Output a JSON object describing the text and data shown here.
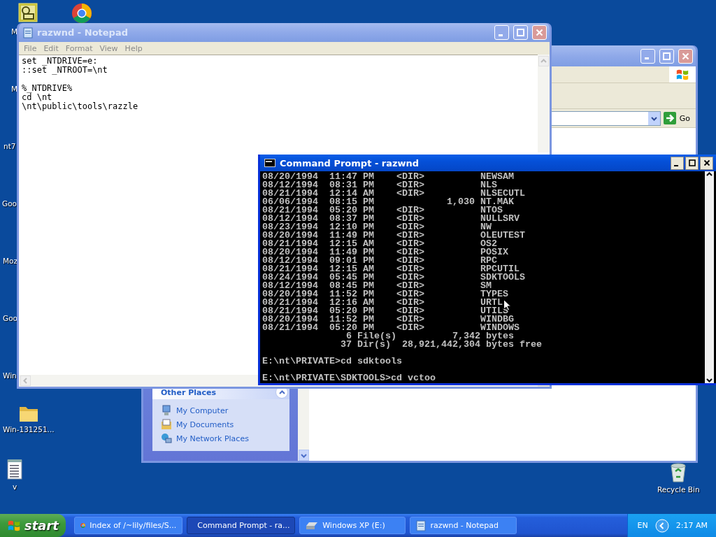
{
  "desktop_icons": [
    {
      "kind": "clock"
    },
    {
      "kind": "browser"
    },
    {
      "kind": "label",
      "label": "M"
    },
    {
      "kind": "label",
      "label": "M"
    },
    {
      "kind": "label",
      "label": "nt7"
    },
    {
      "kind": "label",
      "label": "Goo"
    },
    {
      "kind": "label",
      "label": "Moz"
    },
    {
      "kind": "label",
      "label": "Goo"
    },
    {
      "kind": "label",
      "label": "Win"
    },
    {
      "kind": "folder",
      "label": "Win-131251..."
    },
    {
      "kind": "document",
      "label": "v"
    },
    {
      "kind": "recycle",
      "label": "Recycle Bin"
    }
  ],
  "explorer": {
    "address": {
      "go": "Go"
    },
    "other_places": {
      "title": "Other Places",
      "expanded": true,
      "links": [
        {
          "kind": "computer",
          "label": "My Computer"
        },
        {
          "kind": "documents",
          "label": "My Documents"
        },
        {
          "kind": "network",
          "label": "My Network Places"
        }
      ]
    }
  },
  "notepad": {
    "title": "razwnd - Notepad",
    "active": false,
    "menu": [
      "File",
      "Edit",
      "Format",
      "View",
      "Help"
    ],
    "paragraphs": [
      [
        "set _NTDRIVE=e:",
        "::set _NTROOT=\\nt"
      ],
      [
        "%_NTDRIVE%",
        "cd \\nt",
        "\\nt\\public\\tools\\razzle"
      ]
    ]
  },
  "command_prompt": {
    "title": "Command Prompt - razwnd",
    "active": true,
    "blocks": [
      [
        "08/20/1994  11:47 PM    <DIR>          NEWSAM",
        "08/12/1994  08:31 PM    <DIR>          NLS",
        "08/21/1994  12:14 AM    <DIR>          NLSECUTL",
        "06/06/1994  08:15 PM             1,030 NT.MAK",
        "08/21/1994  05:20 PM    <DIR>          NTOS",
        "08/12/1994  08:37 PM    <DIR>          NULLSRV",
        "08/23/1994  12:10 PM    <DIR>          NW",
        "08/20/1994  11:49 PM    <DIR>          OLEUTEST",
        "08/21/1994  12:15 AM    <DIR>          OS2",
        "08/20/1994  11:49 PM    <DIR>          POSIX",
        "08/12/1994  09:01 PM    <DIR>          RPC",
        "08/21/1994  12:15 AM    <DIR>          RPCUTIL",
        "08/24/1994  05:45 PM    <DIR>          SDKTOOLS",
        "08/12/1994  08:45 PM    <DIR>          SM",
        "08/20/1994  11:52 PM    <DIR>          TYPES",
        "08/21/1994  12:16 AM    <DIR>          URTL",
        "08/21/1994  05:20 PM    <DIR>          UTILS",
        "08/20/1994  11:52 PM    <DIR>          WINDBG",
        "08/21/1994  05:20 PM    <DIR>          WINDOWS",
        "               6 File(s)          7,342 bytes",
        "              37 Dir(s)  28,921,442,304 bytes free"
      ],
      [
        "E:\\nt\\PRIVATE>cd sdktools"
      ],
      [
        "E:\\nt\\PRIVATE\\SDKTOOLS>cd vctoo"
      ]
    ]
  },
  "taskbar": {
    "start": "start",
    "tasks": [
      {
        "kind": "browser",
        "label": "Index of /~lily/files/S...",
        "selected": false
      },
      {
        "kind": "console",
        "label": "Command Prompt - ra...",
        "selected": true
      },
      {
        "kind": "drive",
        "label": "Windows XP (E:)",
        "selected": false
      },
      {
        "kind": "notepad",
        "label": "razwnd - Notepad",
        "selected": false
      }
    ],
    "language": "EN",
    "clock": "2:17 AM"
  }
}
